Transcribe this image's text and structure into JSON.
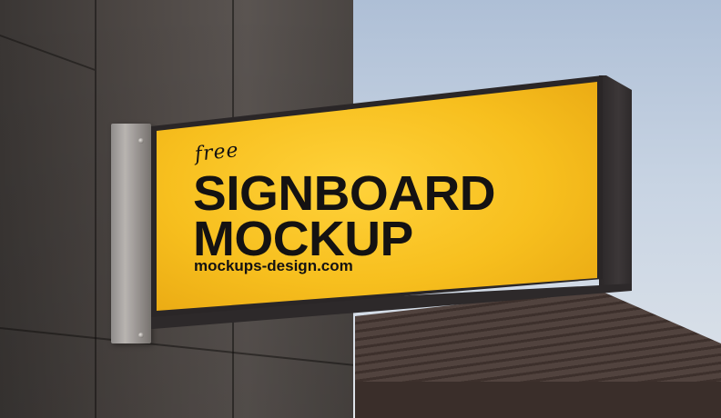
{
  "sign": {
    "script_word": "free",
    "headline_line1": "SIGNBOARD",
    "headline_line2": "MOCKUP",
    "website": "mockups-design.com"
  },
  "colors": {
    "sign_face": "#f7bf1e",
    "sign_frame": "#2a2627",
    "text": "#141212",
    "sky": "#c8d4e3",
    "wall": "#4e4845"
  }
}
